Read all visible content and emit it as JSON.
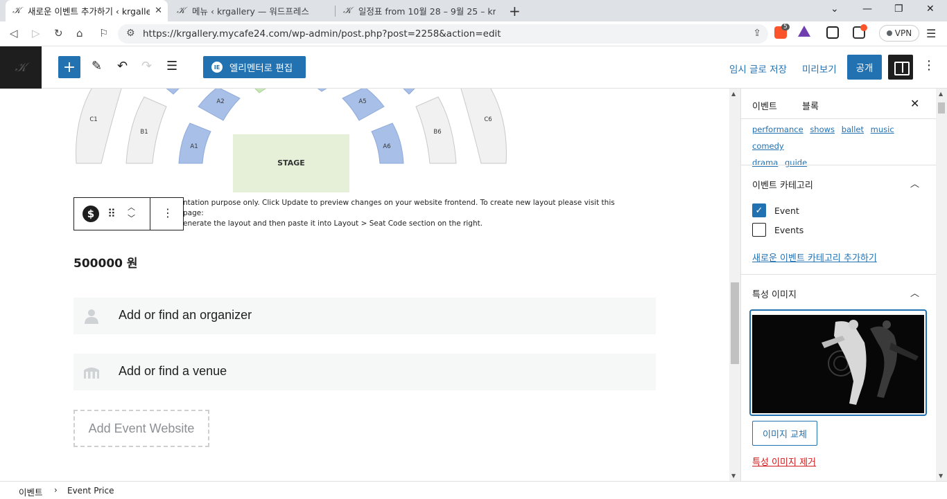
{
  "browser": {
    "tabs": [
      {
        "title": "새로운 이벤트 추가하기 ‹ krgallery",
        "active": true
      },
      {
        "title": "메뉴 ‹ krgallery — 워드프레스",
        "active": false
      },
      {
        "title": "일정표 from 10월 28 – 9월 25 – krgallery",
        "active": false
      }
    ],
    "url": "https://krgallery.mycafe24.com/wp-admin/post.php?post=2258&action=edit",
    "vpn_label": "VPN",
    "brave_count": "5"
  },
  "header": {
    "elementor_label": "엘리멘터로 편집",
    "elementor_badge": "IE",
    "save_draft": "임시 글로 저장",
    "preview": "미리보기",
    "publish": "공개"
  },
  "seating": {
    "sections": [
      "A1",
      "A2",
      "A5",
      "A6",
      "B1",
      "B6",
      "C1",
      "C6"
    ],
    "stage_label": "STAGE"
  },
  "canvas": {
    "notice_line1": "ntation purpose only. Click Update to preview changes on your website frontend. To create new layout please visit this page:",
    "notice_line2": "enerate the layout and then paste it into Layout > Seat Code section on the right.",
    "price": "500000 원",
    "organizer": "Add or find an organizer",
    "venue": "Add or find a venue",
    "website": "Add Event Website"
  },
  "sidebar": {
    "tab_event": "이벤트",
    "tab_block": "블록",
    "tags": [
      "performance",
      "shows",
      "ballet",
      "music",
      "comedy",
      "drama",
      "guide"
    ],
    "category_title": "이벤트 카테고리",
    "categories": [
      {
        "label": "Event",
        "checked": true
      },
      {
        "label": "Events",
        "checked": false
      }
    ],
    "add_category": "새로운 이벤트 카테고리 추가하기",
    "featured_title": "특성 이미지",
    "replace_image": "이미지 교체",
    "remove_image": "특성 이미지 제거"
  },
  "footer": {
    "crumb_root": "이벤트",
    "crumb_current": "Event Price"
  },
  "colors": {
    "accent": "#2271b1",
    "seat_blue": "#a8c0e8",
    "seat_gray": "#f1f1f1",
    "stage_green": "#e6f0d8"
  }
}
